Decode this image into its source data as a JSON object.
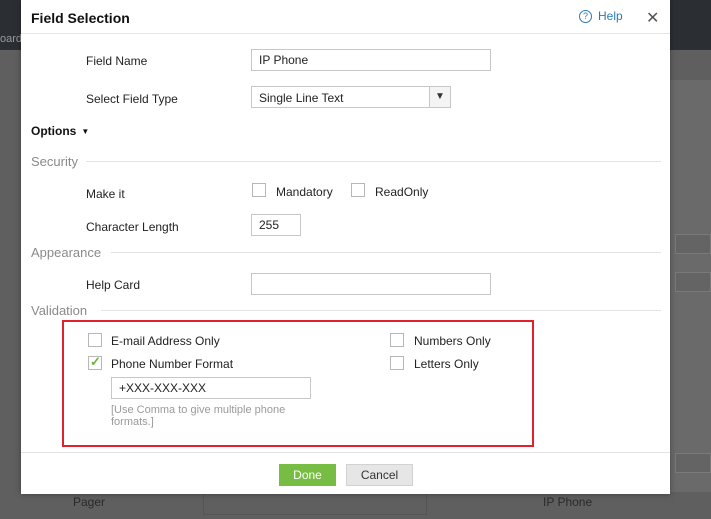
{
  "background": {
    "topbar_fragment": "oard",
    "pager_label": "Pager",
    "ip_phone_label": "IP Phone"
  },
  "dialog": {
    "title": "Field Selection",
    "help_label": "Help",
    "help_icon_glyph": "?",
    "close_glyph": "✕",
    "field_name_label": "Field Name",
    "field_name_value": "IP Phone",
    "field_type_label": "Select Field Type",
    "field_type_value": "Single Line Text",
    "options_label": "Options",
    "security": {
      "section_label": "Security",
      "make_it_label": "Make it",
      "mandatory_label": "Mandatory",
      "readonly_label": "ReadOnly",
      "char_length_label": "Character Length",
      "char_length_value": "255"
    },
    "appearance": {
      "section_label": "Appearance",
      "help_card_label": "Help Card",
      "help_card_value": ""
    },
    "validation": {
      "section_label": "Validation",
      "email_only_label": "E-mail Address Only",
      "email_only_checked": false,
      "phone_format_label": "Phone Number Format",
      "phone_format_checked": true,
      "phone_format_value": "+XXX-XXX-XXX",
      "phone_format_hint": "[Use Comma to give multiple phone formats.]",
      "numbers_only_label": "Numbers Only",
      "numbers_only_checked": false,
      "letters_only_label": "Letters Only",
      "letters_only_checked": false
    },
    "done_label": "Done",
    "cancel_label": "Cancel"
  },
  "colors": {
    "accent_green": "#78bd43",
    "highlight_red": "#e0202a",
    "link_blue": "#2a7ab8"
  }
}
